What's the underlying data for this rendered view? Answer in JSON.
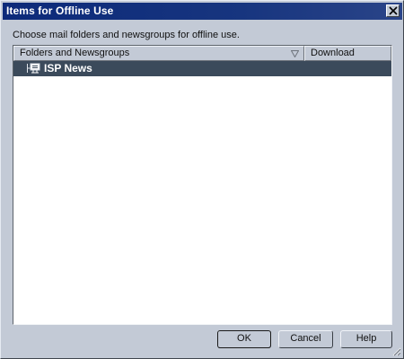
{
  "window": {
    "title": "Items for Offline Use"
  },
  "instruction_text": "Choose mail folders and newsgroups for offline use.",
  "list": {
    "columns": [
      {
        "label": "Folders and Newsgroups",
        "sort_indicator": "sort-descending-triangle-icon"
      },
      {
        "label": "Download"
      }
    ],
    "rows": [
      {
        "label": "ISP News",
        "icon": "newsgroup-server-icon",
        "download": "",
        "selected": true
      }
    ]
  },
  "buttons": {
    "ok": "OK",
    "cancel": "Cancel",
    "help": "Help"
  },
  "colors": {
    "title_bar": "#17357f",
    "dialog_face": "#c3cad6",
    "selection": "#3b4a5b"
  }
}
